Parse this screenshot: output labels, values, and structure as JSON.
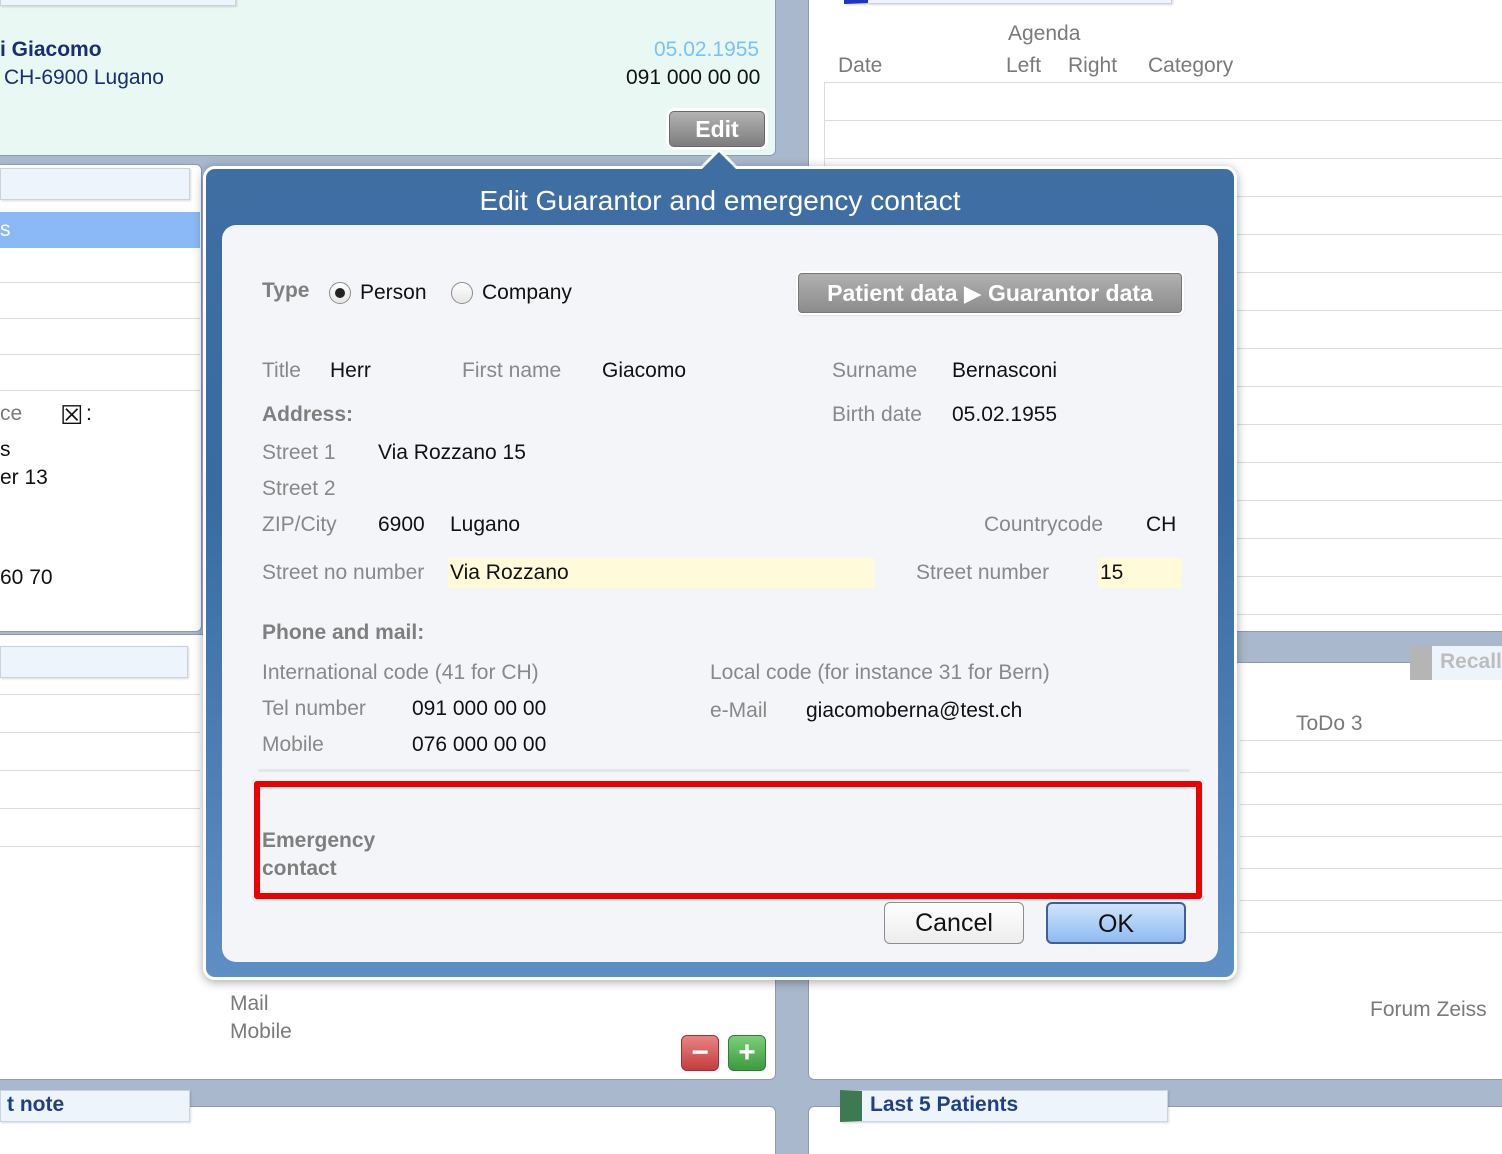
{
  "background": {
    "patient_card": {
      "name": "i Giacomo",
      "address": "CH-6900 Lugano",
      "birth_date": "05.02.1955",
      "phone": "091 000 00 00",
      "edit_label": "Edit"
    },
    "left_panel": {
      "selected_fragment": "s",
      "field_fragment": "ce",
      "checkbox_glyph": "☒",
      "checkbox_suffix": ":",
      "text_s": "s",
      "text_er13": "er 13",
      "text_6070": "60 70",
      "mail_label": "Mail",
      "mobile_label": "Mobile",
      "note_tab": "t note"
    },
    "agenda": {
      "header_agenda": "Agenda",
      "col_date": "Date",
      "col_left": "Left",
      "col_right": "Right",
      "col_category": "Category"
    },
    "recall_tab": "Recall",
    "todo_label": "ToDo 3",
    "forum_label": "Forum Zeiss",
    "last5_tab": "Last 5 Patients"
  },
  "dialog": {
    "title": "Edit Guarantor and emergency contact",
    "type_label": "Type",
    "type_options": [
      "Person",
      "Company"
    ],
    "type_selected": "Person",
    "transfer_button": "Patient data ▶ Guarantor data",
    "title_label": "Title",
    "title_value": "Herr",
    "first_name_label": "First name",
    "first_name_value": "Giacomo",
    "surname_label": "Surname",
    "surname_value": "Bernasconi",
    "address_heading": "Address:",
    "birth_date_label": "Birth date",
    "birth_date_value": "05.02.1955",
    "street1_label": "Street 1",
    "street1_value": "Via Rozzano 15",
    "street2_label": "Street 2",
    "street2_value": "",
    "zipcity_label": "ZIP/City",
    "zip_value": "6900",
    "city_value": "Lugano",
    "countrycode_label": "Countrycode",
    "countrycode_value": "CH",
    "street_no_number_label": "Street no number",
    "street_no_number_value": "Via Rozzano",
    "street_number_label": "Street number",
    "street_number_value": "15",
    "phone_heading": "Phone and mail:",
    "intl_code_hint": "International code (41 for CH)",
    "local_code_hint": "Local code (for instance 31 for Bern)",
    "tel_label": "Tel number",
    "tel_value": "091 000 00 00",
    "email_label": "e-Mail",
    "email_value": "giacomoberna@test.ch",
    "mobile_label": "Mobile",
    "mobile_value": "076 000 00 00",
    "emergency_label_line1": "Emergency",
    "emergency_label_line2": "contact",
    "cancel_label": "Cancel",
    "ok_label": "OK"
  },
  "colors": {
    "dialog_blue": "#3b6aa3",
    "highlight_yellow": "#fffbd9",
    "annotation_red": "#ee0000",
    "birthdate_blue": "#79c3f3"
  }
}
